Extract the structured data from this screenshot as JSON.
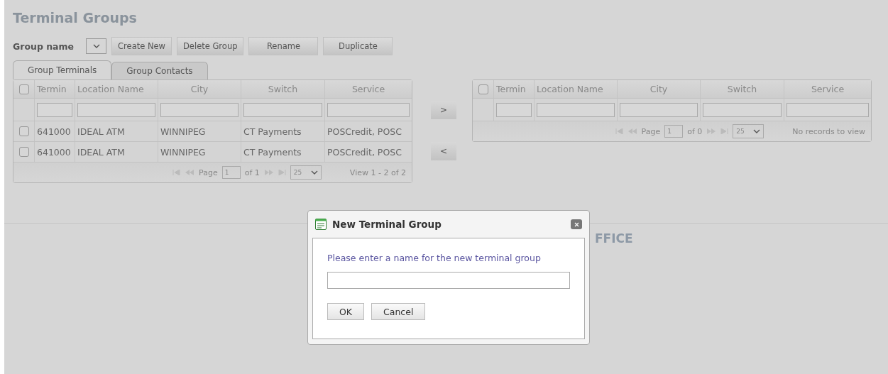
{
  "page_title": "Terminal Groups",
  "toolbar": {
    "label": "Group name",
    "buttons": [
      "Create New",
      "Delete Group",
      "Rename",
      "Duplicate"
    ]
  },
  "tabs": [
    {
      "label": "Group Terminals",
      "selected": true
    },
    {
      "label": "Group Contacts",
      "selected": false
    }
  ],
  "left_grid": {
    "columns": [
      "Termin",
      "Location Name",
      "City",
      "Switch",
      "Service"
    ],
    "header_checked": false,
    "rows": [
      {
        "checked": false,
        "cells": [
          "641000",
          "IDEAL ATM",
          "WINNIPEG",
          "CT Payments",
          "POSCredit, POSC"
        ]
      },
      {
        "checked": false,
        "cells": [
          "641000",
          "IDEAL ATM",
          "WINNIPEG",
          "CT Payments",
          "POSCredit, POSC"
        ]
      }
    ],
    "pager": {
      "page_label": "Page",
      "page": "1",
      "of": "of 1",
      "page_size": "25",
      "info": "View 1 - 2 of 2"
    }
  },
  "move_buttons": [
    ">",
    "<"
  ],
  "right_grid": {
    "columns": [
      "Termin",
      "Location Name",
      "City",
      "Switch",
      "Service"
    ],
    "header_checked": false,
    "pager": {
      "page_label": "Page",
      "page": "1",
      "of": "of 0",
      "page_size": "25",
      "info": "No records to view"
    }
  },
  "logo_text": "FFICE",
  "dialog": {
    "title": "New Terminal Group",
    "prompt": "Please enter a name for the new terminal group",
    "buttons": [
      "OK",
      "Cancel"
    ]
  }
}
